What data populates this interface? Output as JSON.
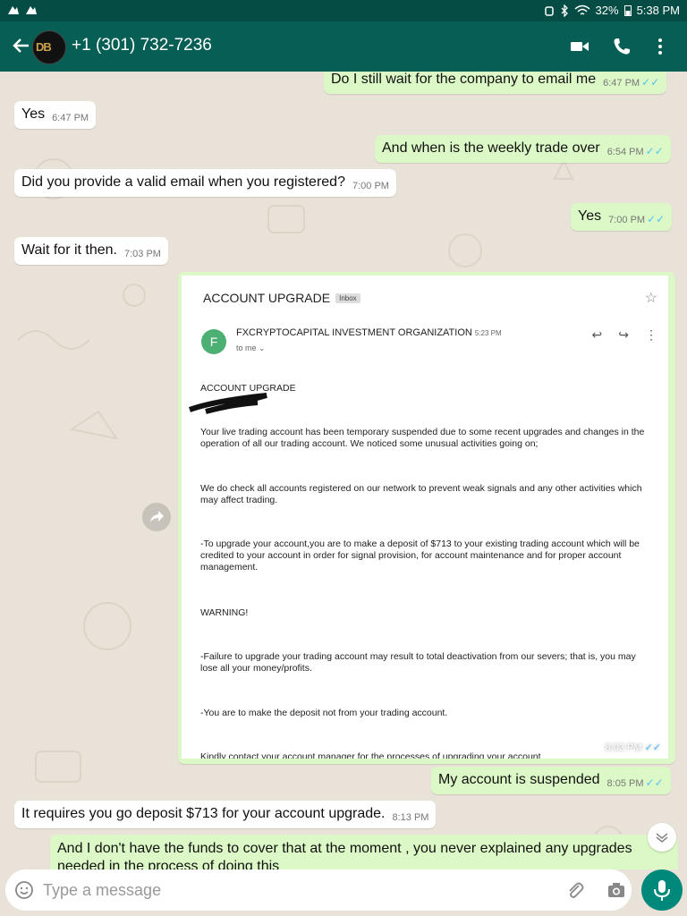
{
  "status": {
    "battery": "32%",
    "time": "5:38 PM"
  },
  "header": {
    "contact": "+1 (301) 732-7236",
    "avatar_text": "DB"
  },
  "messages": [
    {
      "text": "Do I still wait for the company to email me",
      "time": "6:47 PM",
      "dir": "out"
    },
    {
      "text": "Yes",
      "time": "6:47 PM",
      "dir": "in"
    },
    {
      "text": "And when is the weekly trade over",
      "time": "6:54 PM",
      "dir": "out"
    },
    {
      "text": "Did you provide a valid email when you registered?",
      "time": "7:00 PM",
      "dir": "in"
    },
    {
      "text": "Yes",
      "time": "7:00 PM",
      "dir": "out"
    },
    {
      "text": "Wait for it then.",
      "time": "7:03 PM",
      "dir": "in"
    },
    {
      "text": "My account is suspended",
      "time": "8:05 PM",
      "dir": "out"
    },
    {
      "text": "It requires you go deposit $713 for your account upgrade.",
      "time": "8:13 PM",
      "dir": "in"
    },
    {
      "text": "And I don't have the funds to cover that at the moment , you never explained any upgrades",
      "text2": "needed in  the process of doing this",
      "time": "8:14 PM",
      "dir": "out"
    }
  ],
  "email": {
    "subject": "ACCOUNT UPGRADE",
    "label": "Inbox",
    "sender_initial": "F",
    "sender": "FXCRYPTOCAPITAL INVESTMENT ORGANIZATION",
    "sent_time": "5:23 PM",
    "to": "to me",
    "heading": "ACCOUNT UPGRADE",
    "para1": "Your live trading account has been temporary suspended due to some recent upgrades and changes in the operation of all our trading account. We noticed some unusual activities going on;",
    "para2": "We do check all accounts registered on our network to prevent weak signals and any other activities which may affect trading.",
    "para3": "-To upgrade your account,you are to make a deposit of $713 to your existing trading account which will be credited to your account in order for signal provision, for account maintenance and for proper account management.",
    "para4": "WARNING!",
    "para5": "-Failure to upgrade your trading account may result to total deactivation from our severs; that is, you may lose all your money/profits.",
    "para6": "-You are to make the deposit not from your trading account.",
    "para7": "Kindly contact your account manager for the processes of upgrading your account.",
    "bubble_time": "8:03 PM"
  },
  "input": {
    "placeholder": "Type a message"
  },
  "colors": {
    "header": "#075e54",
    "statusbar": "#054d44",
    "outgoing": "#dcf8c6",
    "incoming": "#ffffff",
    "read_ticks": "#4fc3f7",
    "mic_button": "#00897b"
  }
}
